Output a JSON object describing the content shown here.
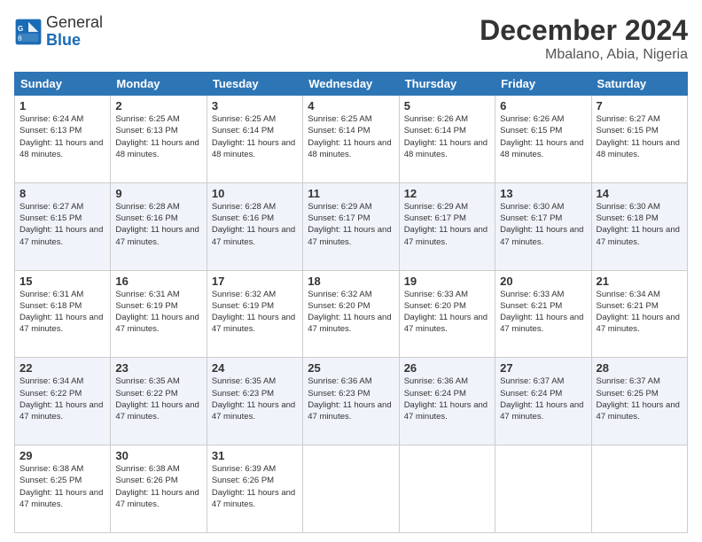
{
  "logo": {
    "line1": "General",
    "line2": "Blue"
  },
  "title": "December 2024",
  "subtitle": "Mbalano, Abia, Nigeria",
  "weekdays": [
    "Sunday",
    "Monday",
    "Tuesday",
    "Wednesday",
    "Thursday",
    "Friday",
    "Saturday"
  ],
  "weeks": [
    [
      {
        "day": "1",
        "sunrise": "6:24 AM",
        "sunset": "6:13 PM",
        "daylight": "11 hours and 48 minutes."
      },
      {
        "day": "2",
        "sunrise": "6:25 AM",
        "sunset": "6:13 PM",
        "daylight": "11 hours and 48 minutes."
      },
      {
        "day": "3",
        "sunrise": "6:25 AM",
        "sunset": "6:14 PM",
        "daylight": "11 hours and 48 minutes."
      },
      {
        "day": "4",
        "sunrise": "6:25 AM",
        "sunset": "6:14 PM",
        "daylight": "11 hours and 48 minutes."
      },
      {
        "day": "5",
        "sunrise": "6:26 AM",
        "sunset": "6:14 PM",
        "daylight": "11 hours and 48 minutes."
      },
      {
        "day": "6",
        "sunrise": "6:26 AM",
        "sunset": "6:15 PM",
        "daylight": "11 hours and 48 minutes."
      },
      {
        "day": "7",
        "sunrise": "6:27 AM",
        "sunset": "6:15 PM",
        "daylight": "11 hours and 48 minutes."
      }
    ],
    [
      {
        "day": "8",
        "sunrise": "6:27 AM",
        "sunset": "6:15 PM",
        "daylight": "11 hours and 47 minutes."
      },
      {
        "day": "9",
        "sunrise": "6:28 AM",
        "sunset": "6:16 PM",
        "daylight": "11 hours and 47 minutes."
      },
      {
        "day": "10",
        "sunrise": "6:28 AM",
        "sunset": "6:16 PM",
        "daylight": "11 hours and 47 minutes."
      },
      {
        "day": "11",
        "sunrise": "6:29 AM",
        "sunset": "6:17 PM",
        "daylight": "11 hours and 47 minutes."
      },
      {
        "day": "12",
        "sunrise": "6:29 AM",
        "sunset": "6:17 PM",
        "daylight": "11 hours and 47 minutes."
      },
      {
        "day": "13",
        "sunrise": "6:30 AM",
        "sunset": "6:17 PM",
        "daylight": "11 hours and 47 minutes."
      },
      {
        "day": "14",
        "sunrise": "6:30 AM",
        "sunset": "6:18 PM",
        "daylight": "11 hours and 47 minutes."
      }
    ],
    [
      {
        "day": "15",
        "sunrise": "6:31 AM",
        "sunset": "6:18 PM",
        "daylight": "11 hours and 47 minutes."
      },
      {
        "day": "16",
        "sunrise": "6:31 AM",
        "sunset": "6:19 PM",
        "daylight": "11 hours and 47 minutes."
      },
      {
        "day": "17",
        "sunrise": "6:32 AM",
        "sunset": "6:19 PM",
        "daylight": "11 hours and 47 minutes."
      },
      {
        "day": "18",
        "sunrise": "6:32 AM",
        "sunset": "6:20 PM",
        "daylight": "11 hours and 47 minutes."
      },
      {
        "day": "19",
        "sunrise": "6:33 AM",
        "sunset": "6:20 PM",
        "daylight": "11 hours and 47 minutes."
      },
      {
        "day": "20",
        "sunrise": "6:33 AM",
        "sunset": "6:21 PM",
        "daylight": "11 hours and 47 minutes."
      },
      {
        "day": "21",
        "sunrise": "6:34 AM",
        "sunset": "6:21 PM",
        "daylight": "11 hours and 47 minutes."
      }
    ],
    [
      {
        "day": "22",
        "sunrise": "6:34 AM",
        "sunset": "6:22 PM",
        "daylight": "11 hours and 47 minutes."
      },
      {
        "day": "23",
        "sunrise": "6:35 AM",
        "sunset": "6:22 PM",
        "daylight": "11 hours and 47 minutes."
      },
      {
        "day": "24",
        "sunrise": "6:35 AM",
        "sunset": "6:23 PM",
        "daylight": "11 hours and 47 minutes."
      },
      {
        "day": "25",
        "sunrise": "6:36 AM",
        "sunset": "6:23 PM",
        "daylight": "11 hours and 47 minutes."
      },
      {
        "day": "26",
        "sunrise": "6:36 AM",
        "sunset": "6:24 PM",
        "daylight": "11 hours and 47 minutes."
      },
      {
        "day": "27",
        "sunrise": "6:37 AM",
        "sunset": "6:24 PM",
        "daylight": "11 hours and 47 minutes."
      },
      {
        "day": "28",
        "sunrise": "6:37 AM",
        "sunset": "6:25 PM",
        "daylight": "11 hours and 47 minutes."
      }
    ],
    [
      {
        "day": "29",
        "sunrise": "6:38 AM",
        "sunset": "6:25 PM",
        "daylight": "11 hours and 47 minutes."
      },
      {
        "day": "30",
        "sunrise": "6:38 AM",
        "sunset": "6:26 PM",
        "daylight": "11 hours and 47 minutes."
      },
      {
        "day": "31",
        "sunrise": "6:39 AM",
        "sunset": "6:26 PM",
        "daylight": "11 hours and 47 minutes."
      },
      null,
      null,
      null,
      null
    ]
  ]
}
